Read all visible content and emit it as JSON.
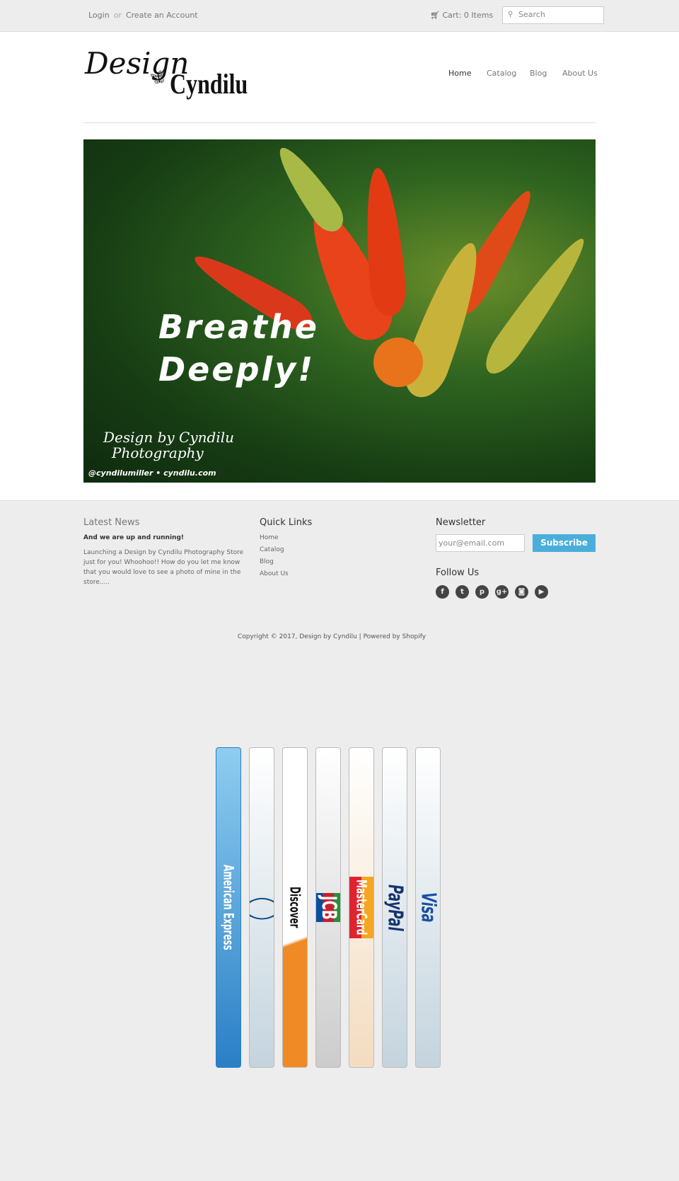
{
  "topbar": {
    "login": "Login",
    "or": "or",
    "create_account": "Create an Account",
    "cart": "Cart: 0 Items",
    "search_placeholder": "Search"
  },
  "logo": {
    "line1": "Design",
    "by": "by",
    "line2": "Cyndilu"
  },
  "nav": [
    "Home",
    "Catalog",
    "Blog",
    "About Us"
  ],
  "hero": {
    "headline1": "Breathe",
    "headline2": "Deeply!",
    "watermark1": "Design by Cyndilu",
    "watermark2": "Photography",
    "credit": "@cyndilumiller  •  cyndilu.com"
  },
  "footer": {
    "latest_news": {
      "title": "Latest News",
      "post_title": "And we are up and running!",
      "post_excerpt": "Launching a Design by Cyndilu Photography Store just for you! Whoohoo!! How do you let me know that you would love to see a photo of mine in the store....."
    },
    "quick_links": {
      "title": "Quick Links",
      "items": [
        "Home",
        "Catalog",
        "Blog",
        "About Us"
      ]
    },
    "newsletter": {
      "title": "Newsletter",
      "email_placeholder": "your@email.com",
      "subscribe": "Subscribe"
    },
    "follow": {
      "title": "Follow Us",
      "icons": [
        "facebook-icon",
        "twitter-icon",
        "pinterest-icon",
        "google-plus-icon",
        "instagram-icon",
        "youtube-icon"
      ]
    },
    "copyright": "Copyright © 2017, Design by Cyndilu | Powered by Shopify"
  },
  "payments": [
    "American Express",
    "Diners Club",
    "Discover",
    "JCB",
    "MasterCard",
    "PayPal",
    "Visa"
  ],
  "colors": {
    "accent": "#4aaedb",
    "background": "#ededed"
  }
}
